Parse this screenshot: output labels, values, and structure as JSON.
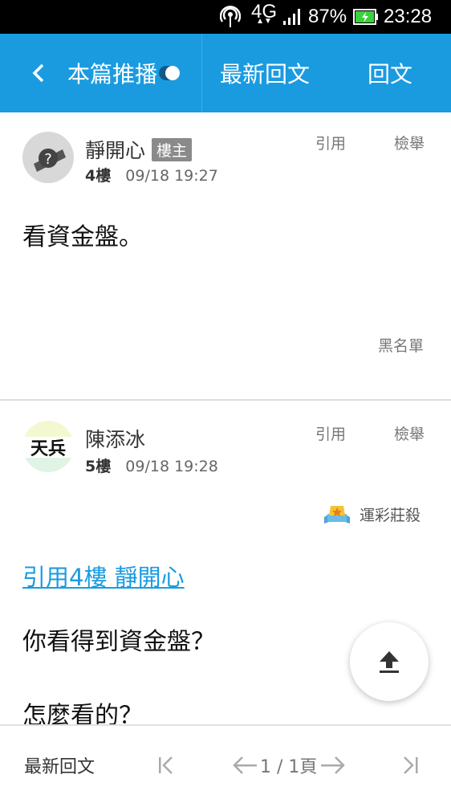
{
  "status_bar": {
    "network": "4G",
    "battery_percent": "87%",
    "time": "23:28"
  },
  "app_bar": {
    "title": "本篇推播",
    "latest_reply": "最新回文",
    "reply": "回文"
  },
  "posts": [
    {
      "author": "靜開心",
      "op_badge": "樓主",
      "floor": "4樓",
      "time": "09/18 19:27",
      "quote_action": "引用",
      "report_action": "檢舉",
      "body": "看資金盤。",
      "blacklist": "黑名單"
    },
    {
      "author": "陳添冰",
      "floor": "5樓",
      "time": "09/18 19:28",
      "quote_action": "引用",
      "report_action": "檢舉",
      "badge_label": "運彩莊殺",
      "quote_link": "引用4樓 靜開心",
      "body_line1": "你看得到資金盤？",
      "body_line2": "怎麼看的？"
    }
  ],
  "bottom_bar": {
    "latest_reply": "最新回文",
    "page_indicator": "1 / 1頁"
  },
  "colors": {
    "primary": "#1a9be0",
    "status_bar": "#000000"
  }
}
